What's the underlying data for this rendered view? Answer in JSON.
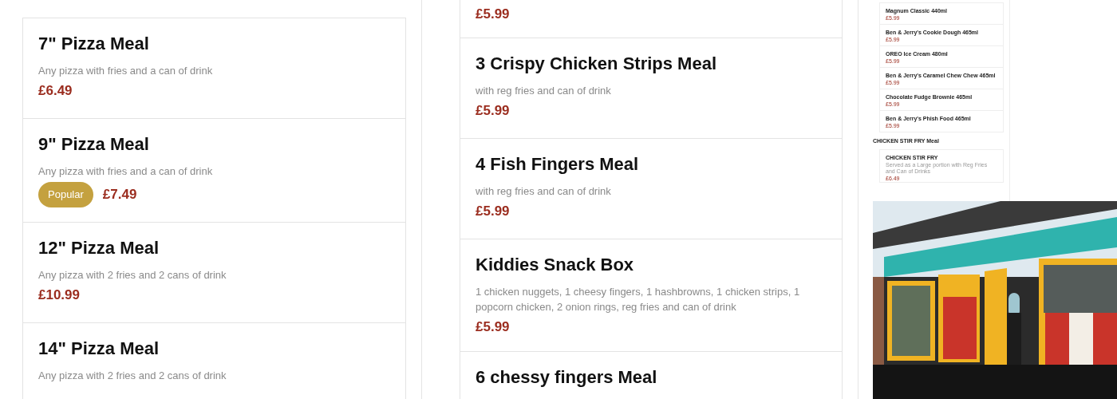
{
  "columns": [
    {
      "items": [
        {
          "kind": "meal",
          "name": "7\" Pizza Meal",
          "description": "Any pizza with fries and a can of drink",
          "price": "£6.49"
        },
        {
          "kind": "meal",
          "name": "9\" Pizza Meal",
          "description": "Any pizza with fries and a can of drink",
          "badge": "Popular",
          "price": "£7.49"
        },
        {
          "kind": "meal",
          "name": "12\" Pizza Meal",
          "description": "Any pizza with 2 fries and 2 cans of drink",
          "price": "£10.99"
        },
        {
          "kind": "meal",
          "name": "14\" Pizza Meal",
          "description": "Any pizza with 2 fries and 2 cans of drink"
        }
      ]
    },
    {
      "items": [
        {
          "kind": "cut",
          "price": "£5.99"
        },
        {
          "kind": "meal",
          "name": "3 Crispy Chicken Strips Meal",
          "description": "with reg fries and can of drink",
          "price": "£5.99"
        },
        {
          "kind": "meal",
          "name": "4 Fish Fingers Meal",
          "description": "with reg fries and can of drink",
          "price": "£5.99"
        },
        {
          "kind": "meal",
          "name": "Kiddies Snack Box",
          "description": "1 chicken nuggets, 1 cheesy fingers, 1 hashbrowns, 1 chicken strips, 1 popcorn chicken, 2 onion rings, reg fries and can of drink",
          "price": "£5.99"
        },
        {
          "kind": "meal",
          "name": "6 chessy fingers Meal"
        }
      ]
    }
  ],
  "preview": {
    "items": [
      {
        "kind": "item",
        "name": "Magnum Classic 440ml",
        "price": "£5.99"
      },
      {
        "kind": "item",
        "name": "Ben & Jerry's Cookie Dough 465ml",
        "price": "£5.99"
      },
      {
        "kind": "item",
        "name": "OREO Ice Cream 480ml",
        "price": "£5.99"
      },
      {
        "kind": "item",
        "name": "Ben & Jerry's Caramel Chew Chew 465ml",
        "price": "£5.99"
      },
      {
        "kind": "item",
        "name": "Chocolate Fudge Brownie 465ml",
        "price": "£5.99"
      },
      {
        "kind": "item",
        "name": "Ben & Jerry's Phish Food 465ml",
        "price": "£5.99"
      },
      {
        "kind": "heading",
        "name": "CHICKEN STIR FRY Meal"
      },
      {
        "kind": "item",
        "name": "CHICKEN STIR FRY",
        "description": "Served as a Large portion with Reg Fries and Can of Drinks",
        "price": "£6.49"
      }
    ]
  }
}
